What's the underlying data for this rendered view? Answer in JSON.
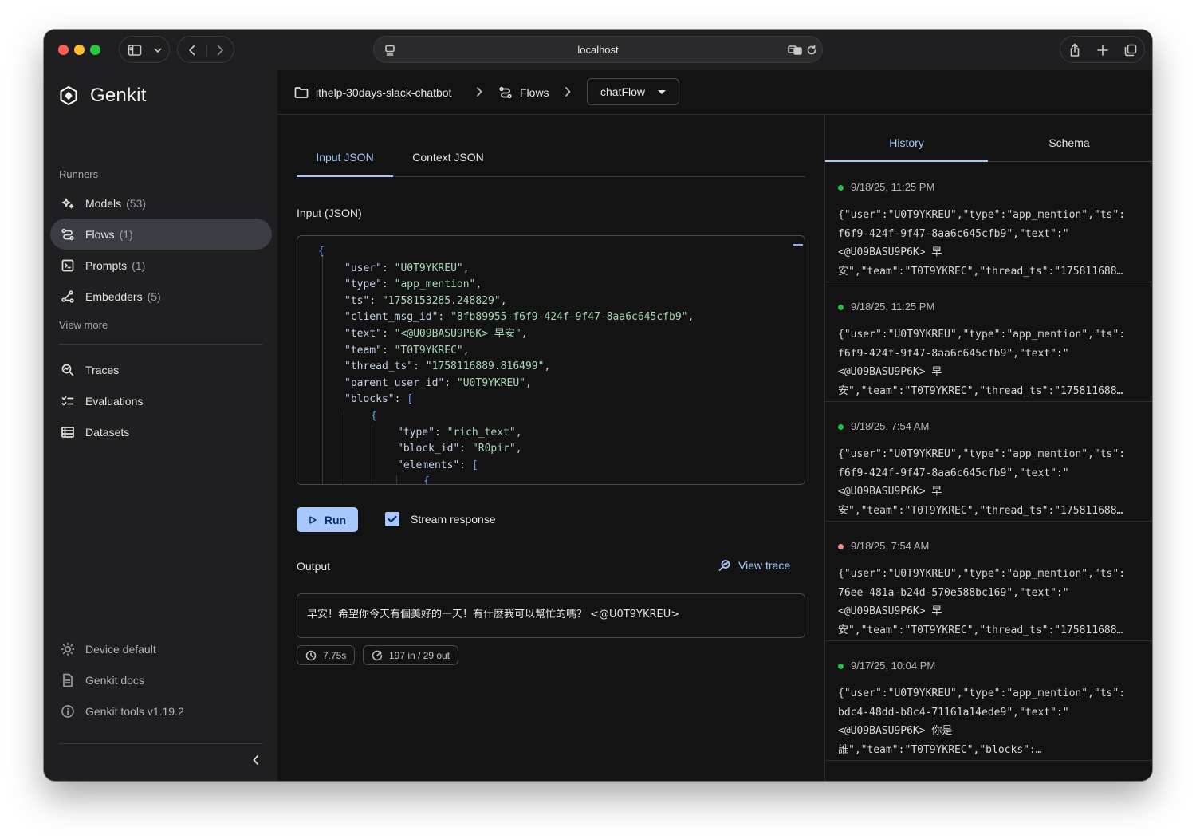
{
  "browser": {
    "url": "localhost"
  },
  "sidebar": {
    "brand": "Genkit",
    "section_label": "Runners",
    "items": [
      {
        "label": "Models",
        "count": "(53)"
      },
      {
        "label": "Flows",
        "count": "(1)"
      },
      {
        "label": "Prompts",
        "count": "(1)"
      },
      {
        "label": "Embedders",
        "count": "(5)"
      }
    ],
    "view_more": "View more",
    "tools": [
      {
        "label": "Traces"
      },
      {
        "label": "Evaluations"
      },
      {
        "label": "Datasets"
      }
    ],
    "footer": [
      {
        "label": "Device default"
      },
      {
        "label": "Genkit docs"
      },
      {
        "label": "Genkit tools v1.19.2"
      }
    ]
  },
  "breadcrumb": {
    "project": "ithelp-30days-slack-chatbot",
    "section": "Flows",
    "selected_flow": "chatFlow"
  },
  "main": {
    "tabs": [
      {
        "label": "Input JSON",
        "active": true
      },
      {
        "label": "Context JSON",
        "active": false
      }
    ],
    "input_label": "Input (JSON)",
    "code_lines": [
      {
        "indent": 0,
        "open": "{"
      },
      {
        "indent": 1,
        "key": "\"user\"",
        "value": "\"U0T9YKREU\"",
        "trail": ","
      },
      {
        "indent": 1,
        "key": "\"type\"",
        "value": "\"app_mention\"",
        "trail": ","
      },
      {
        "indent": 1,
        "key": "\"ts\"",
        "value": "\"1758153285.248829\"",
        "trail": ","
      },
      {
        "indent": 1,
        "key": "\"client_msg_id\"",
        "value": "\"8fb89955-f6f9-424f-9f47-8aa6c645cfb9\"",
        "trail": ","
      },
      {
        "indent": 1,
        "key": "\"text\"",
        "value": "\"<@U09BASU9P6K> 早安\"",
        "trail": ","
      },
      {
        "indent": 1,
        "key": "\"team\"",
        "value": "\"T0T9YKREC\"",
        "trail": ","
      },
      {
        "indent": 1,
        "key": "\"thread_ts\"",
        "value": "\"1758116889.816499\"",
        "trail": ","
      },
      {
        "indent": 1,
        "key": "\"parent_user_id\"",
        "value": "\"U0T9YKREU\"",
        "trail": ","
      },
      {
        "indent": 1,
        "key": "\"blocks\"",
        "open": "["
      },
      {
        "indent": 2,
        "open": "{"
      },
      {
        "indent": 3,
        "key": "\"type\"",
        "value": "\"rich_text\"",
        "trail": ","
      },
      {
        "indent": 3,
        "key": "\"block_id\"",
        "value": "\"R0pir\"",
        "trail": ","
      },
      {
        "indent": 3,
        "key": "\"elements\"",
        "open": "["
      },
      {
        "indent": 4,
        "open": "{"
      }
    ],
    "run_label": "Run",
    "stream_label": "Stream response",
    "stream_checked": true,
    "output_label": "Output",
    "view_trace_label": "View trace",
    "output_text": "早安！希望你今天有個美好的一天！有什麼我可以幫忙的嗎？ <@U0T9YKREU>",
    "latency": "7.75s",
    "tokens": "197 in / 29 out"
  },
  "history_panel": {
    "tabs": [
      {
        "label": "History",
        "active": true
      },
      {
        "label": "Schema",
        "active": false
      }
    ],
    "entries": [
      {
        "time": "9/18/25, 11:25 PM",
        "status_color": "#1ec24a",
        "lines": [
          "{\"user\":\"U0T9YKREU\",\"type\":\"app_mention\",\"ts\":",
          "f6f9-424f-9f47-8aa6c645cfb9\",\"text\":\"",
          "<@U09BASU9P6K> 早",
          "安\",\"team\":\"T0T9YKREC\",\"thread_ts\":\"175811688…"
        ]
      },
      {
        "time": "9/18/25, 11:25 PM",
        "status_color": "#1ec24a",
        "lines": [
          "{\"user\":\"U0T9YKREU\",\"type\":\"app_mention\",\"ts\":",
          "f6f9-424f-9f47-8aa6c645cfb9\",\"text\":\"",
          "<@U09BASU9P6K> 早",
          "安\",\"team\":\"T0T9YKREC\",\"thread_ts\":\"175811688…"
        ]
      },
      {
        "time": "9/18/25, 7:54 AM",
        "status_color": "#1ec24a",
        "lines": [
          "{\"user\":\"U0T9YKREU\",\"type\":\"app_mention\",\"ts\":",
          "f6f9-424f-9f47-8aa6c645cfb9\",\"text\":\"",
          "<@U09BASU9P6K> 早",
          "安\",\"team\":\"T0T9YKREC\",\"thread_ts\":\"175811688…"
        ]
      },
      {
        "time": "9/18/25, 7:54 AM",
        "status_color": "#f28b82",
        "lines": [
          "{\"user\":\"U0T9YKREU\",\"type\":\"app_mention\",\"ts\":",
          "76ee-481a-b24d-570e588bc169\",\"text\":\"",
          "<@U09BASU9P6K> 早",
          "安\",\"team\":\"T0T9YKREC\",\"thread_ts\":\"175811688…"
        ]
      },
      {
        "time": "9/17/25, 10:04 PM",
        "status_color": "#1ec24a",
        "lines": [
          "{\"user\":\"U0T9YKREU\",\"type\":\"app_mention\",\"ts\":",
          "bdc4-48dd-b8c4-71161a14ede9\",\"text\":\"",
          "<@U09BASU9P6K> 你是",
          "誰\",\"team\":\"T0T9YKREC\",\"blocks\":…"
        ]
      }
    ]
  }
}
